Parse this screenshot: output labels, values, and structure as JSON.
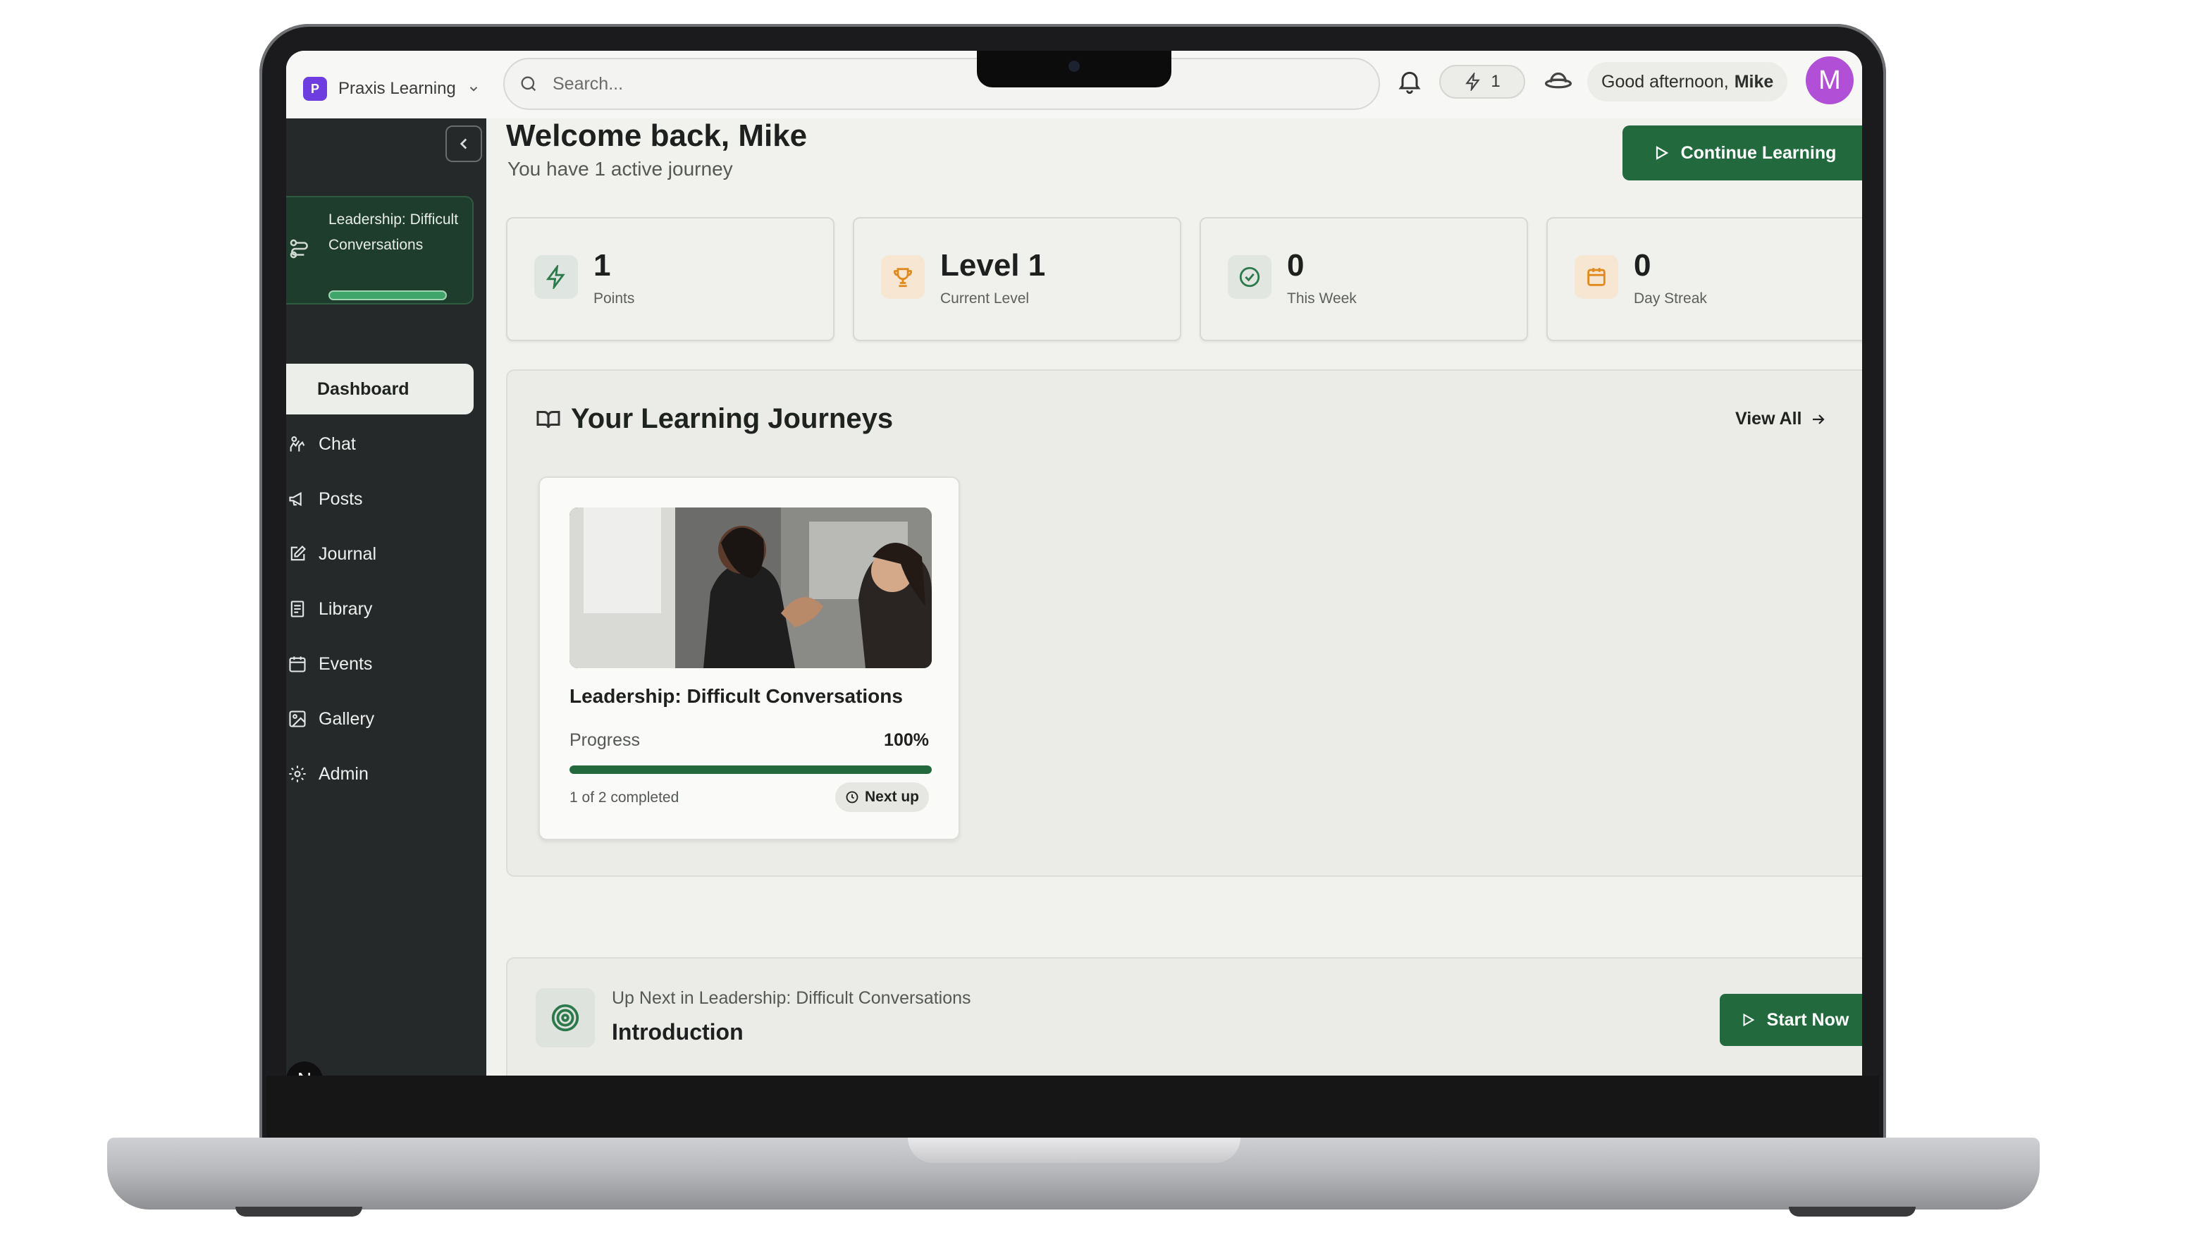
{
  "app": {
    "org_name": "Praxis Learning",
    "org_logo_letter": "P",
    "brand_color": "#226a3e"
  },
  "header": {
    "search_placeholder": "Search...",
    "points_badge": "1",
    "greeting_prefix": "Good afternoon,",
    "greeting_name": "Mike",
    "avatar_letter": "M",
    "avatar_color": "#b14fd6"
  },
  "sidebar": {
    "active_journey": {
      "title": "Leadership: Difficult Conversations",
      "progress": 1.0
    },
    "items": [
      {
        "label": "Dashboard",
        "icon": "dashboard-icon",
        "active": true
      },
      {
        "label": "Chat",
        "icon": "chat-icon"
      },
      {
        "label": "Posts",
        "icon": "megaphone-icon"
      },
      {
        "label": "Journal",
        "icon": "edit-icon"
      },
      {
        "label": "Library",
        "icon": "book-icon"
      },
      {
        "label": "Events",
        "icon": "calendar-icon"
      },
      {
        "label": "Gallery",
        "icon": "image-icon"
      },
      {
        "label": "Admin",
        "icon": "gear-icon"
      }
    ],
    "bottom_badge": "N"
  },
  "main": {
    "welcome": "Welcome back, Mike",
    "subtitle": "You have 1 active journey",
    "continue_button": "Continue Learning",
    "stats": [
      {
        "value": "1",
        "label": "Points",
        "icon": "lightning-icon"
      },
      {
        "value": "Level 1",
        "label": "Current Level",
        "icon": "trophy-icon"
      },
      {
        "value": "0",
        "label": "This Week",
        "icon": "check-circle-icon"
      },
      {
        "value": "0",
        "label": "Day Streak",
        "icon": "calendar-icon"
      }
    ],
    "journeys_section": {
      "title": "Your Learning Journeys",
      "view_all": "View All",
      "course": {
        "title": "Leadership: Difficult Conversations",
        "progress_label": "Progress",
        "progress_value": "100%",
        "progress": 1.0,
        "completed_text": "1 of 2 completed",
        "next_up": "Next up"
      }
    },
    "up_next": {
      "caption": "Up Next in Leadership: Difficult Conversations",
      "title": "Introduction",
      "start_button": "Start Now"
    }
  }
}
